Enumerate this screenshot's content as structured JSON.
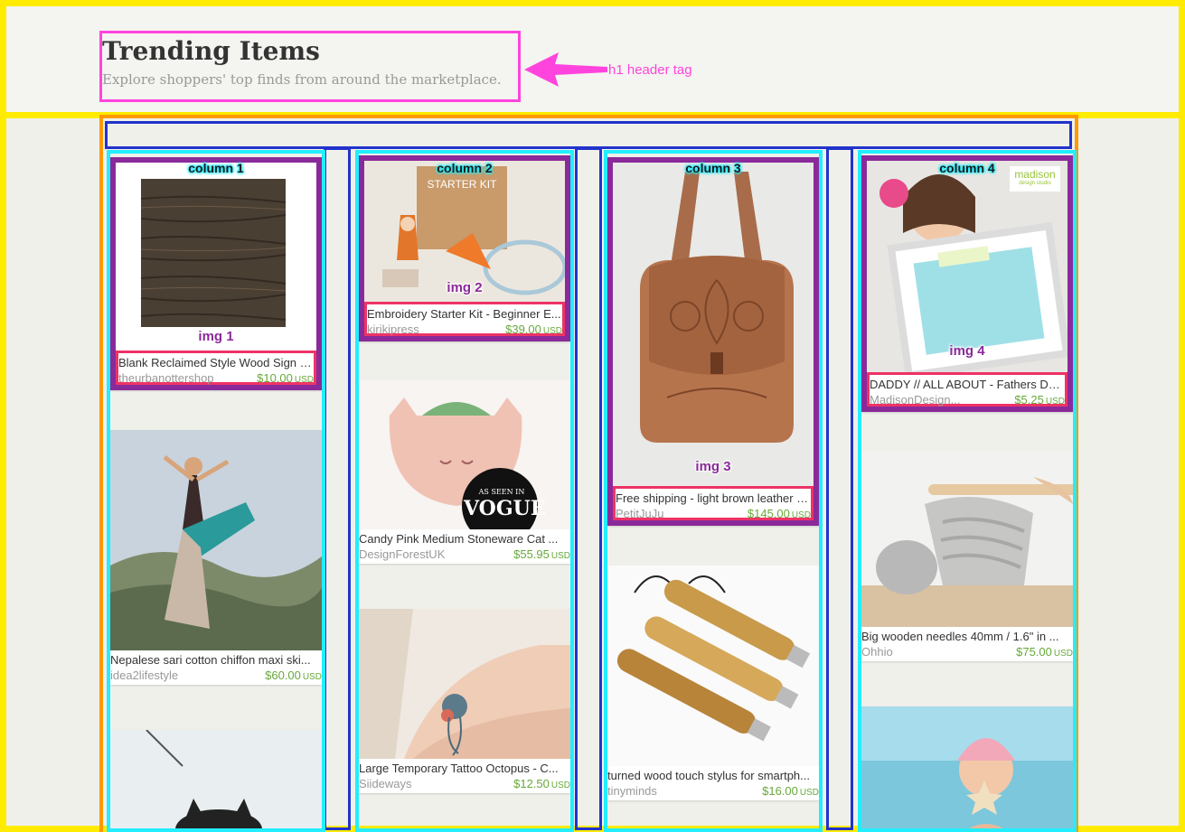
{
  "header": {
    "title": "Trending Items",
    "subtitle": "Explore shoppers' top finds from around the marketplace.",
    "annotation": "h1 header tag"
  },
  "columns": [
    {
      "label": "column 1",
      "cards": [
        {
          "img_label": "img 1",
          "title": "Blank Reclaimed Style Wood Sign wi...",
          "shop": "theurbanottershop",
          "price": "$10.00",
          "currency": "USD"
        },
        {
          "img_label": "",
          "title": "Nepalese sari cotton chiffon maxi ski...",
          "shop": "idea2lifestyle",
          "price": "$60.00",
          "currency": "USD"
        },
        {
          "img_label": "",
          "title": "",
          "shop": "",
          "price": "",
          "currency": ""
        }
      ]
    },
    {
      "label": "column 2",
      "cards": [
        {
          "img_label": "img 2",
          "title": "Embroidery Starter Kit - Beginner E...",
          "shop": "kirikipress",
          "price": "$39.00",
          "currency": "USD"
        },
        {
          "img_label": "",
          "title": "Candy Pink Medium Stoneware Cat ...",
          "shop": "DesignForestUK",
          "price": "$55.95",
          "currency": "USD",
          "badge_top": "AS SEEN IN",
          "badge_main": "VOGUE"
        },
        {
          "img_label": "",
          "title": "Large Temporary Tattoo Octopus - C...",
          "shop": "Siideways",
          "price": "$12.50",
          "currency": "USD"
        }
      ]
    },
    {
      "label": "column 3",
      "cards": [
        {
          "img_label": "img 3",
          "title": "Free shipping - light brown leather ba...",
          "shop": "PetitJuJu",
          "price": "$145.00",
          "currency": "USD"
        },
        {
          "img_label": "",
          "title": "turned wood touch stylus for smartph...",
          "shop": "tinyminds",
          "price": "$16.00",
          "currency": "USD"
        }
      ]
    },
    {
      "label": "column 4",
      "cards": [
        {
          "img_label": "img 4",
          "title": "DADDY // ALL ABOUT - Fathers Day...",
          "shop": "MadisonDesign...",
          "price": "$5.25",
          "currency": "USD",
          "logo_main": "madison",
          "logo_sub": "design studio"
        },
        {
          "img_label": "",
          "title": "Big wooden needles 40mm / 1.6\" in ...",
          "shop": "Ohhio",
          "price": "$75.00",
          "currency": "USD"
        },
        {
          "img_label": "",
          "title": "",
          "shop": "",
          "price": "",
          "currency": ""
        }
      ]
    }
  ],
  "colors": {
    "frame_yellow": "#ffeb00",
    "header_highlight": "#ff44dd",
    "grid_orange": "#ff9900",
    "gutter_blue": "#2233cc",
    "column_cyan": "#22eeff",
    "image_purple": "#8a2a9a",
    "info_red": "#ee3366",
    "price_green": "#67a83a"
  }
}
